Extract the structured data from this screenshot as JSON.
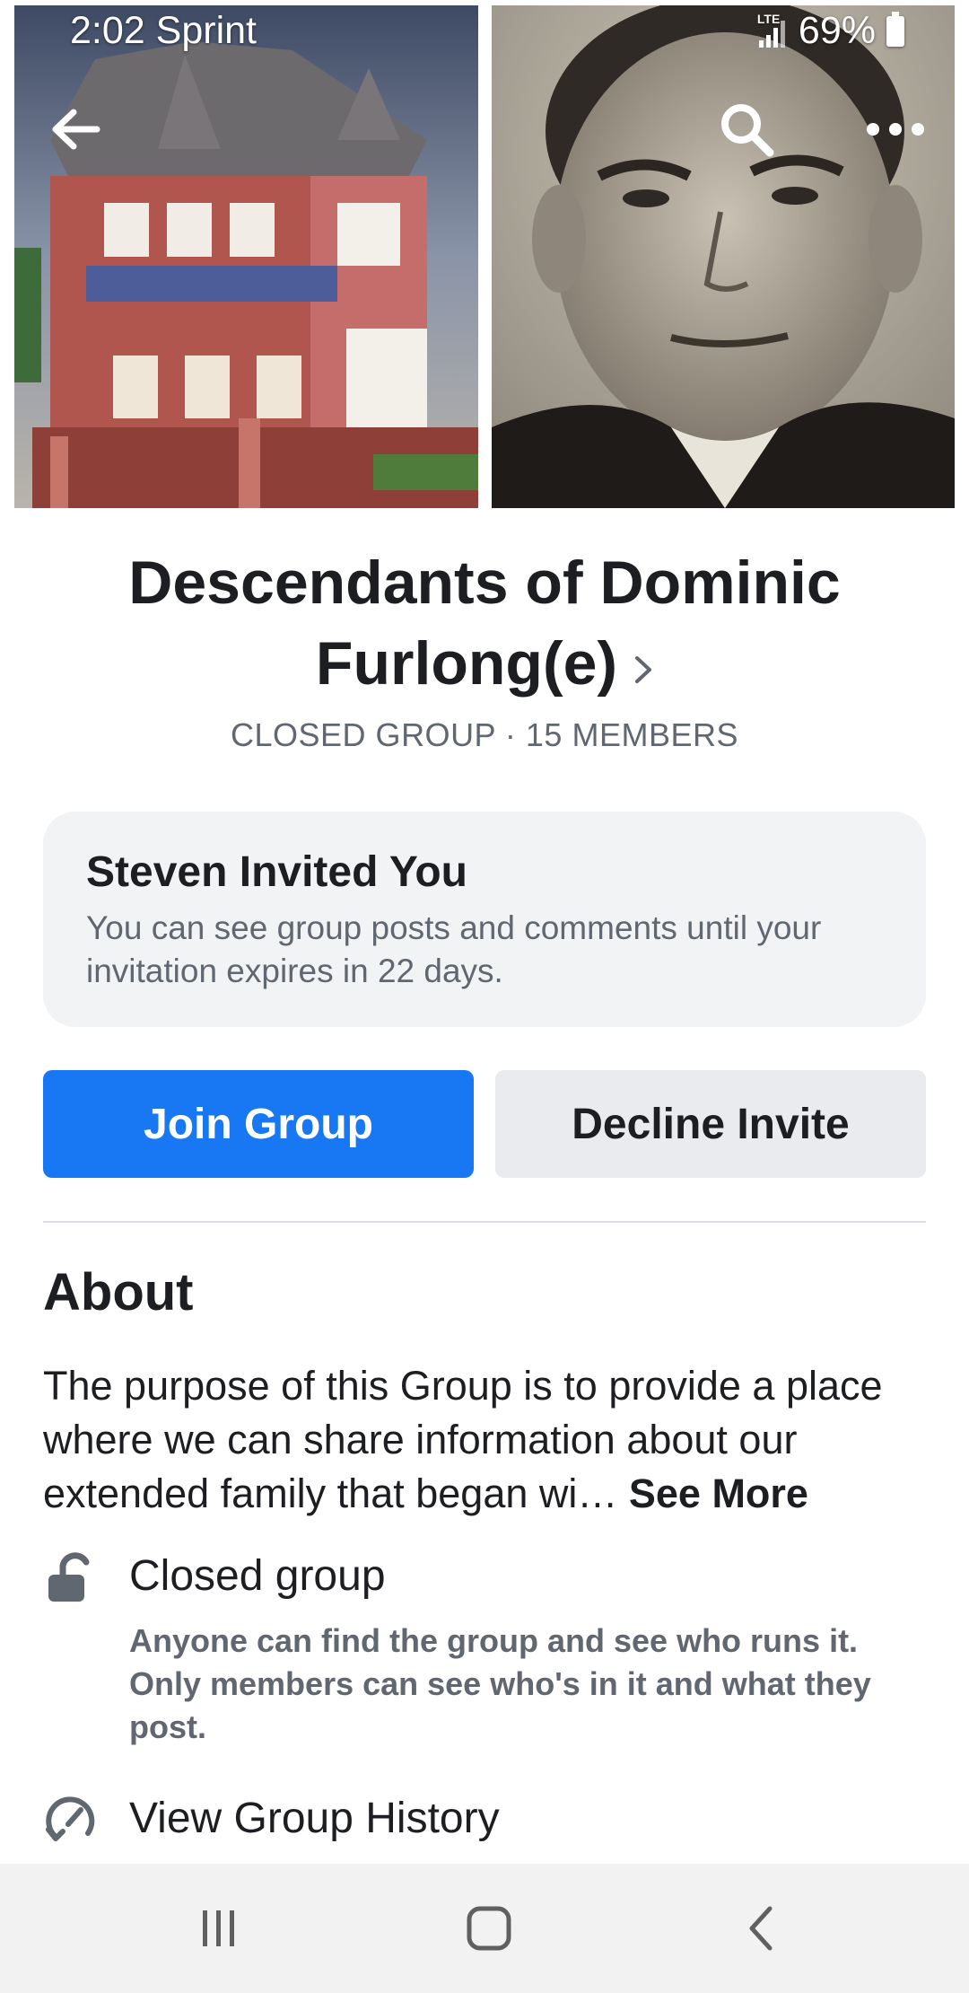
{
  "status_bar": {
    "time": "2:02",
    "carrier": "Sprint",
    "network": "LTE",
    "battery": "69%"
  },
  "header": {
    "back_icon": "arrow-left-icon",
    "search_icon": "search-icon",
    "more_icon": "more-horizontal-icon"
  },
  "group": {
    "title": "Descendants of Dominic Furlong(e)",
    "meta": "CLOSED GROUP · 15 MEMBERS"
  },
  "invite": {
    "title": "Steven Invited You",
    "description": "You can see group posts and comments until your invitation expires in 22 days."
  },
  "actions": {
    "join_label": "Join Group",
    "decline_label": "Decline Invite"
  },
  "about": {
    "heading": "About",
    "text": "The purpose of this Group is to provide a place where we can share information about our extended family that began wi… ",
    "see_more": "See More",
    "privacy_title": "Closed group",
    "privacy_desc": "Anyone can find the group and see who runs it. Only members can see who's in it and what they post.",
    "history_title": "View Group History"
  },
  "colors": {
    "primary": "#1877f2",
    "secondary_button": "#e9ebee",
    "card_background": "#f2f3f5",
    "muted_text": "#606770"
  }
}
